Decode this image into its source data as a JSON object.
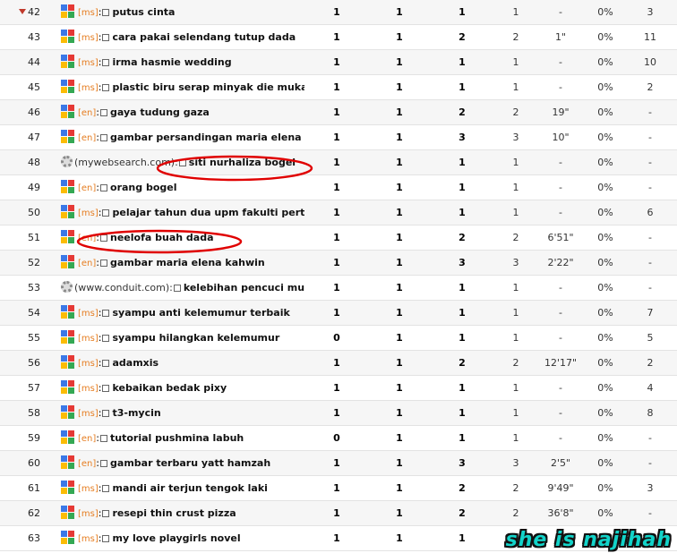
{
  "rows": [
    {
      "n": "42",
      "src": "google",
      "lang": "[ms]",
      "kw": "putus cinta",
      "a": "1",
      "b": "1",
      "c": "1",
      "d": "1",
      "e": "-",
      "f": "0%",
      "g": "3",
      "trend": "down"
    },
    {
      "n": "43",
      "src": "google",
      "lang": "[ms]",
      "kw": "cara pakai selendang tutup dada",
      "a": "1",
      "b": "1",
      "c": "2",
      "d": "2",
      "e": "1\"",
      "f": "0%",
      "g": "11"
    },
    {
      "n": "44",
      "src": "google",
      "lang": "[ms]",
      "kw": "irma hasmie wedding",
      "a": "1",
      "b": "1",
      "c": "1",
      "d": "1",
      "e": "-",
      "f": "0%",
      "g": "10"
    },
    {
      "n": "45",
      "src": "google",
      "lang": "[ms]",
      "kw": "plastic biru serap minyak die muka",
      "a": "1",
      "b": "1",
      "c": "1",
      "d": "1",
      "e": "-",
      "f": "0%",
      "g": "2"
    },
    {
      "n": "46",
      "src": "google",
      "lang": "[en]",
      "kw": "gaya tudung gaza",
      "a": "1",
      "b": "1",
      "c": "2",
      "d": "2",
      "e": "19\"",
      "f": "0%",
      "g": "-"
    },
    {
      "n": "47",
      "src": "google",
      "lang": "[en]",
      "kw": "gambar persandingan maria elena",
      "a": "1",
      "b": "1",
      "c": "3",
      "d": "3",
      "e": "10\"",
      "f": "0%",
      "g": "-"
    },
    {
      "n": "48",
      "src": "gear",
      "site": "(mywebsearch.com):",
      "kw": "siti nurhaliza bogel",
      "a": "1",
      "b": "1",
      "c": "1",
      "d": "1",
      "e": "-",
      "f": "0%",
      "g": "-"
    },
    {
      "n": "49",
      "src": "google",
      "lang": "[en]",
      "kw": "orang bogel",
      "a": "1",
      "b": "1",
      "c": "1",
      "d": "1",
      "e": "-",
      "f": "0%",
      "g": "-"
    },
    {
      "n": "50",
      "src": "google",
      "lang": "[ms]",
      "kw": "pelajar tahun dua upm fakulti pertan",
      "a": "1",
      "b": "1",
      "c": "1",
      "d": "1",
      "e": "-",
      "f": "0%",
      "g": "6"
    },
    {
      "n": "51",
      "src": "google",
      "lang": "[en]",
      "kw": "neelofa buah dada",
      "a": "1",
      "b": "1",
      "c": "2",
      "d": "2",
      "e": "6'51\"",
      "f": "0%",
      "g": "-"
    },
    {
      "n": "52",
      "src": "google",
      "lang": "[en]",
      "kw": "gambar maria elena kahwin",
      "a": "1",
      "b": "1",
      "c": "3",
      "d": "3",
      "e": "2'22\"",
      "f": "0%",
      "g": "-"
    },
    {
      "n": "53",
      "src": "gear",
      "site": "(www.conduit.com):",
      "kw": "kelebihan pencuci muka",
      "a": "1",
      "b": "1",
      "c": "1",
      "d": "1",
      "e": "-",
      "f": "0%",
      "g": "-"
    },
    {
      "n": "54",
      "src": "google",
      "lang": "[ms]",
      "kw": "syampu anti kelemumur terbaik",
      "a": "1",
      "b": "1",
      "c": "1",
      "d": "1",
      "e": "-",
      "f": "0%",
      "g": "7"
    },
    {
      "n": "55",
      "src": "google",
      "lang": "[ms]",
      "kw": "syampu hilangkan kelemumur",
      "a": "0",
      "b": "1",
      "c": "1",
      "d": "1",
      "e": "-",
      "f": "0%",
      "g": "5"
    },
    {
      "n": "56",
      "src": "google",
      "lang": "[ms]",
      "kw": "adamxis",
      "a": "1",
      "b": "1",
      "c": "2",
      "d": "2",
      "e": "12'17\"",
      "f": "0%",
      "g": "2"
    },
    {
      "n": "57",
      "src": "google",
      "lang": "[ms]",
      "kw": "kebaikan bedak pixy",
      "a": "1",
      "b": "1",
      "c": "1",
      "d": "1",
      "e": "-",
      "f": "0%",
      "g": "4"
    },
    {
      "n": "58",
      "src": "google",
      "lang": "[ms]",
      "kw": "t3-mycin",
      "a": "1",
      "b": "1",
      "c": "1",
      "d": "1",
      "e": "-",
      "f": "0%",
      "g": "8"
    },
    {
      "n": "59",
      "src": "google",
      "lang": "[en]",
      "kw": "tutorial pushmina labuh",
      "a": "0",
      "b": "1",
      "c": "1",
      "d": "1",
      "e": "-",
      "f": "0%",
      "g": "-"
    },
    {
      "n": "60",
      "src": "google",
      "lang": "[en]",
      "kw": "gambar terbaru yatt hamzah",
      "a": "1",
      "b": "1",
      "c": "3",
      "d": "3",
      "e": "2'5\"",
      "f": "0%",
      "g": "-"
    },
    {
      "n": "61",
      "src": "google",
      "lang": "[ms]",
      "kw": "mandi air terjun tengok laki",
      "a": "1",
      "b": "1",
      "c": "2",
      "d": "2",
      "e": "9'49\"",
      "f": "0%",
      "g": "3"
    },
    {
      "n": "62",
      "src": "google",
      "lang": "[ms]",
      "kw": "resepi thin crust pizza",
      "a": "1",
      "b": "1",
      "c": "2",
      "d": "2",
      "e": "36'8\"",
      "f": "0%",
      "g": "-"
    },
    {
      "n": "63",
      "src": "google",
      "lang": "[ms]",
      "kw": "my love playgirls novel",
      "a": "1",
      "b": "1",
      "c": "1",
      "d": "",
      "e": "",
      "f": "",
      "g": ""
    }
  ],
  "watermark": "she is najihah",
  "colors": {
    "lang": "#e67e22",
    "highlight": "#e00000",
    "watermark": "#12d3c9"
  }
}
